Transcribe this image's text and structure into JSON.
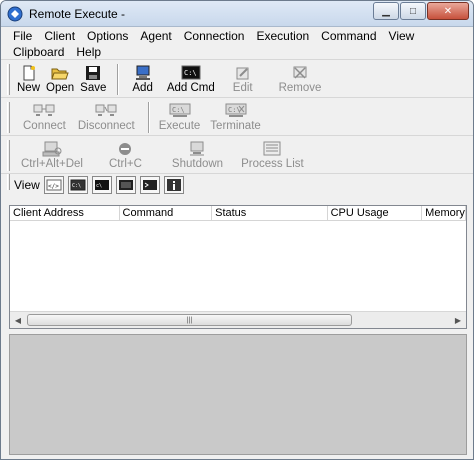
{
  "window": {
    "title": "Remote Execute -"
  },
  "menu": [
    "File",
    "Client",
    "Options",
    "Agent",
    "Connection",
    "Execution",
    "Command",
    "View",
    "Clipboard",
    "Help"
  ],
  "toolbar1": [
    {
      "label": "New",
      "icon": "new-file-icon"
    },
    {
      "label": "Open",
      "icon": "open-folder-icon"
    },
    {
      "label": "Save",
      "icon": "save-disk-icon"
    },
    {
      "label": "Add",
      "icon": "add-computer-icon"
    },
    {
      "label": "Add Cmd",
      "icon": "add-command-icon"
    },
    {
      "label": "Edit",
      "icon": "edit-icon"
    },
    {
      "label": "Remove",
      "icon": "remove-icon"
    }
  ],
  "toolbar2": [
    {
      "label": "Connect",
      "icon": "connect-icon"
    },
    {
      "label": "Disconnect",
      "icon": "disconnect-icon"
    },
    {
      "label": "Execute",
      "icon": "execute-icon"
    },
    {
      "label": "Terminate",
      "icon": "terminate-icon"
    }
  ],
  "toolbar3": [
    {
      "label": "Ctrl+Alt+Del",
      "icon": "ctrl-alt-del-icon"
    },
    {
      "label": "Ctrl+C",
      "icon": "ctrl-c-icon"
    },
    {
      "label": "Shutdown",
      "icon": "shutdown-icon"
    },
    {
      "label": "Process List",
      "icon": "process-list-icon"
    }
  ],
  "viewbar": {
    "label": "View"
  },
  "columns": [
    "Client Address",
    "Command",
    "Status",
    "CPU Usage",
    "Memory"
  ],
  "colors": {
    "titlebar": "#c8d8ec",
    "close": "#c7513c",
    "bottom_pane": "#c9c9c9"
  }
}
